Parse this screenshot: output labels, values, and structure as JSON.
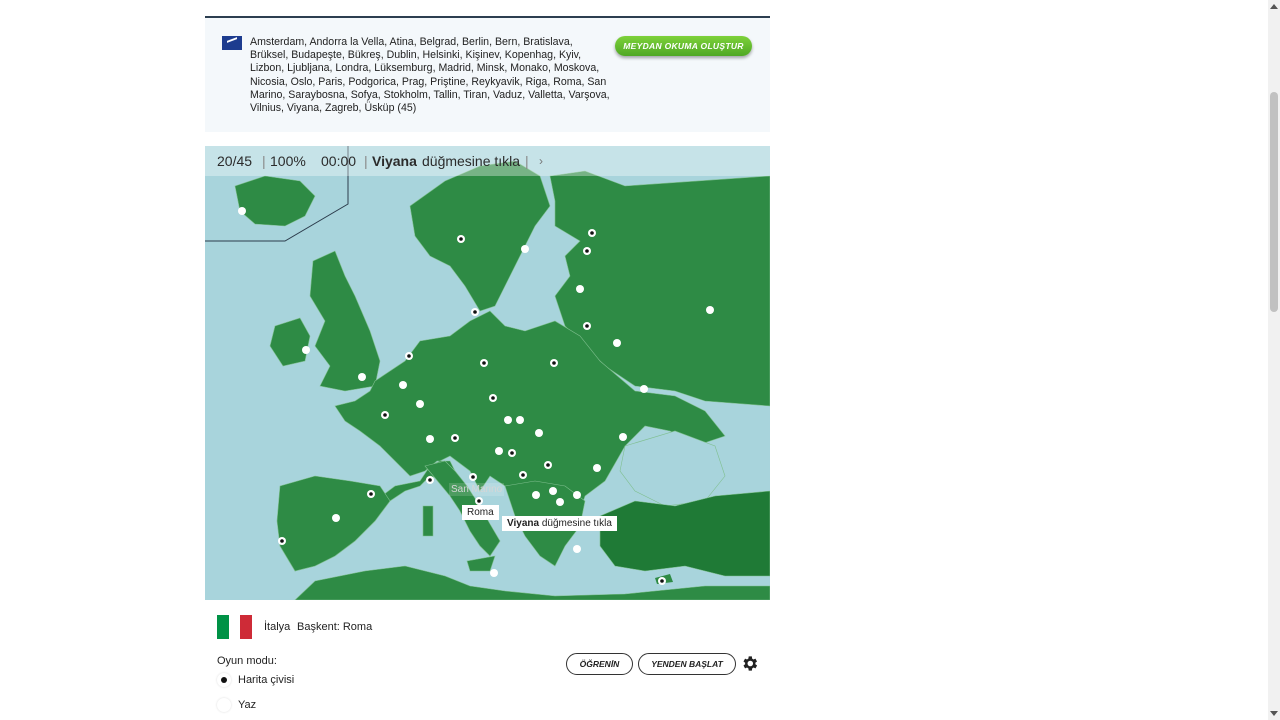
{
  "info": {
    "cities_text": "Amsterdam, Andorra la Vella, Atina, Belgrad, Berlin, Bern, Bratislava, Brüksel, Budapeşte, Bükreş, Dublin, Helsinki, Kişinev, Kopenhag, Kyiv, Lizbon, Ljubljana, Londra, Lüksemburg, Madrid, Minsk, Monako, Moskova, Nicosia, Oslo, Paris, Podgorica, Prag, Priştine, Reykyavik, Riga, Roma, San Marino, Saraybosna, Sofya, Stokholm, Tallin, Tiran, Vaduz, Valletta, Varşova, Vilnius, Viyana, Zagreb, Üsküp (45)",
    "make_quiz_label": "MEYDAN OKUMA OLUŞTUR",
    "flag_icon": "eu-flag-icon"
  },
  "status": {
    "progress": "20/45",
    "accuracy": "100%",
    "timer": "00:00",
    "target_city": "Viyana",
    "prompt_suffix": "düğmesine tıkla",
    "skip_icon": "chevron-right-icon"
  },
  "map": {
    "hover_label": "Roma",
    "ghost_label": "San Marino",
    "tooltip_city": "Viyana",
    "tooltip_suffix": "düğmesine tıkla",
    "colors": {
      "land": "#2e8b45",
      "sea": "#a8d4dc",
      "turkey": "#1f7a36"
    }
  },
  "selection": {
    "country": "İtalya",
    "capital": "Başkent: Roma",
    "flag_colors": [
      "#009246",
      "#ffffff",
      "#ce2b37"
    ]
  },
  "mode": {
    "label": "Oyun modu:",
    "options": [
      "Harita çivisi",
      "Yaz"
    ],
    "selected": "Harita çivisi"
  },
  "buttons": {
    "learn": "ÖĞRENİN",
    "restart": "YENDEN BAŞLAT",
    "settings_icon": "gear-icon"
  }
}
